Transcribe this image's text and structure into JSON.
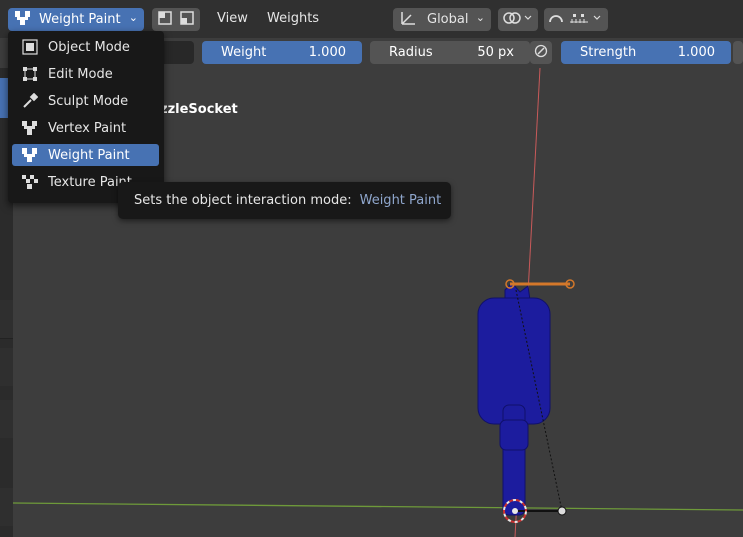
{
  "header": {
    "mode_label": "Weight Paint",
    "menus": [
      "View",
      "Weights"
    ],
    "orientation_label": "Global"
  },
  "tool_settings": {
    "weight": {
      "label": "Weight",
      "value": "1.000"
    },
    "radius": {
      "label": "Radius",
      "value": "50 px"
    },
    "strength": {
      "label": "Strength",
      "value": "1.000"
    }
  },
  "mode_menu": {
    "items": [
      {
        "label": "Object Mode",
        "icon": "object-mode-icon"
      },
      {
        "label": "Edit Mode",
        "icon": "edit-mode-icon"
      },
      {
        "label": "Sculpt Mode",
        "icon": "sculpt-mode-icon"
      },
      {
        "label": "Vertex Paint",
        "icon": "vertex-paint-icon"
      },
      {
        "label": "Weight Paint",
        "icon": "weight-paint-icon",
        "selected": true
      },
      {
        "label": "Texture Paint",
        "icon": "texture-paint-icon"
      }
    ]
  },
  "tooltip": {
    "text": "Sets the object interaction mode:",
    "value": "Weight Paint"
  },
  "viewport": {
    "object_name_fragment": "zzleSocket"
  },
  "colors": {
    "accent": "#4772b3",
    "mesh": "#1c1c9e",
    "bone": "#d4782a",
    "y_axis": "#c95a5a",
    "x_axis": "#6e9a3a"
  }
}
